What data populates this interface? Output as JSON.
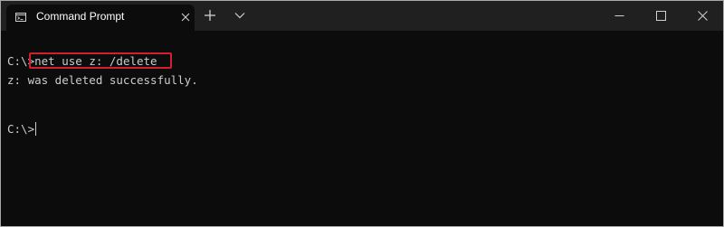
{
  "window": {
    "tab_title": "Command Prompt",
    "tab_icon": "cmd-icon",
    "controls": [
      "minimize-icon",
      "maximize-icon",
      "close-icon"
    ]
  },
  "console": {
    "line1_prompt": "C:\\>",
    "line1_command": "net use z: /delete",
    "line2_output": "z: was deleted successfully.",
    "line3_prompt": "C:\\>"
  },
  "colors": {
    "background": "#0c0c0c",
    "titlebar": "#202020",
    "text": "#cccccc",
    "highlight": "#d0202f"
  }
}
